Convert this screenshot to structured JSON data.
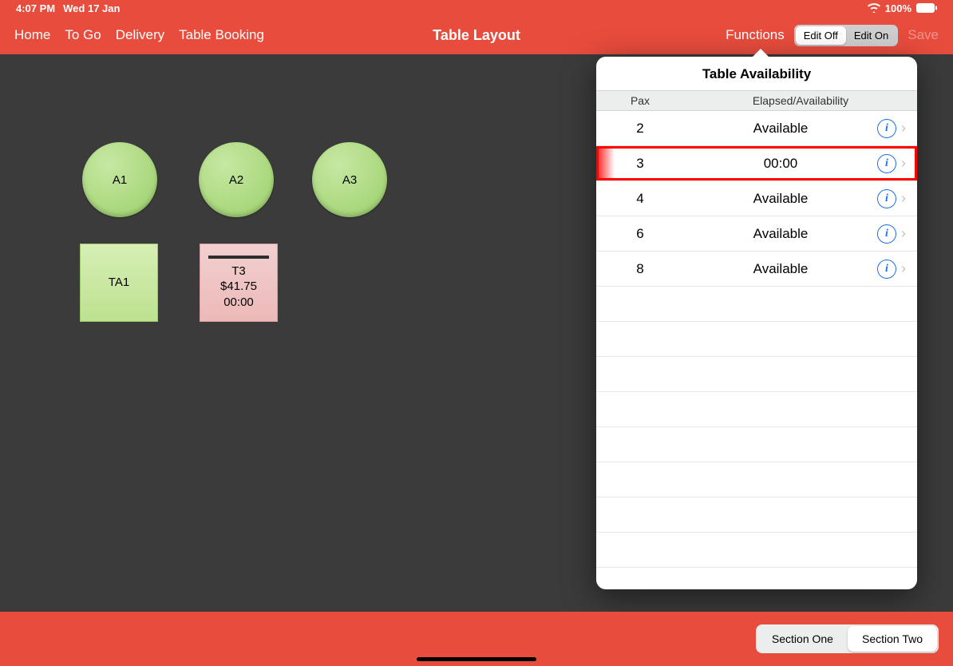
{
  "status": {
    "time": "4:07 PM",
    "date": "Wed 17 Jan",
    "battery": "100%"
  },
  "nav": {
    "home": "Home",
    "togo": "To Go",
    "delivery": "Delivery",
    "booking": "Table Booking",
    "title": "Table Layout",
    "functions": "Functions",
    "edit_off": "Edit Off",
    "edit_on": "Edit On",
    "save": "Save"
  },
  "tables": {
    "a1": "A1",
    "a2": "A2",
    "a3": "A3",
    "ta1": "TA1",
    "t3_name": "T3",
    "t3_amount": "$41.75",
    "t3_time": "00:00"
  },
  "popover": {
    "title": "Table Availability",
    "col_pax": "Pax",
    "col_status": "Elapsed/Availability",
    "rows": [
      {
        "pax": "2",
        "status": "Available",
        "hl": false
      },
      {
        "pax": "3",
        "status": "00:00",
        "hl": true
      },
      {
        "pax": "4",
        "status": "Available",
        "hl": false
      },
      {
        "pax": "6",
        "status": "Available",
        "hl": false
      },
      {
        "pax": "8",
        "status": "Available",
        "hl": false
      }
    ]
  },
  "sections": {
    "one": "Section One",
    "two": "Section Two"
  }
}
